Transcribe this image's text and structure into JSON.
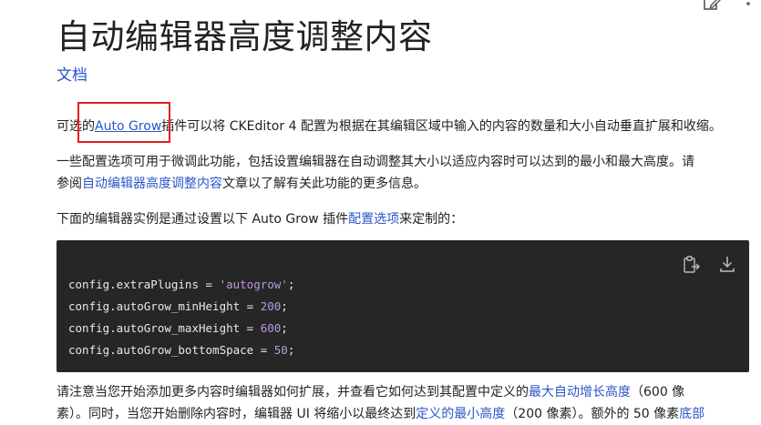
{
  "toolbar": {
    "edit_icon": "edit-icon",
    "menu_icon": "menu-icon"
  },
  "page_title": "自动编辑器高度调整内容",
  "doc_link": "文档",
  "p1": {
    "before": "可选的",
    "link": "Auto Grow",
    "after": "插件可以将 CKEditor 4 配置为根据在其编辑区域中输入的内容的数量和大小自动垂直扩展和收缩。"
  },
  "p2": {
    "line1": "一些配置选项可用于微调此功能，包括设置编辑器在自动调整其大小以适应内容时可以达到的最小和最大高度。请",
    "before": "参阅",
    "link": "自动编辑器高度调整内容",
    "after": "文章以了解有关此功能的更多信息。"
  },
  "p3": {
    "before": "下面的编辑器实例是通过设置以下 Auto Grow 插件",
    "link": "配置选项",
    "after": "来定制的："
  },
  "code": {
    "line1_prefix": "config.extraPlugins = ",
    "line1_value": "'autogrow'",
    "line1_suffix": ";",
    "line2_prefix": "config.autoGrow_minHeight = ",
    "line2_value": "200",
    "line2_suffix": ";",
    "line3_prefix": "config.autoGrow_maxHeight = ",
    "line3_value": "600",
    "line3_suffix": ";",
    "line4_prefix": "config.autoGrow_bottomSpace = ",
    "line4_value": "50",
    "line4_suffix": ";",
    "copy_icon": "copy-icon",
    "download_icon": "download-icon"
  },
  "p4": {
    "before": "请注意当您开始添加更多内容时编辑器如何扩展，并查看它如何达到其配置中定义的",
    "link": "最大自动增长高度",
    "after": "（600 像"
  },
  "p5": {
    "before": "素）。同时，当您开始删除内容时，编辑器 UI 将缩小以最终达到",
    "link": "定义的最小高度",
    "after": "（200 像素）。额外的 50 像素",
    "link2": "底部"
  },
  "colors": {
    "link": "#2b56c8",
    "highlight": "#e0201c",
    "code_bg": "#262626"
  }
}
